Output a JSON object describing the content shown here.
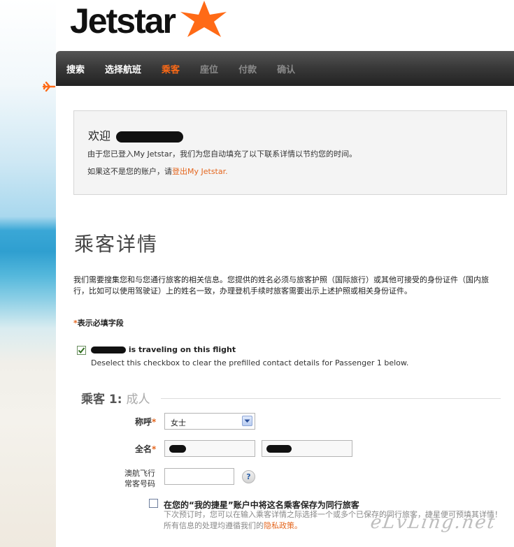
{
  "brand": {
    "logo_text": "Jetstar",
    "accent_color": "#ff6a16"
  },
  "nav": {
    "items": [
      {
        "label": "搜索",
        "state": "done"
      },
      {
        "label": "选择航班",
        "state": "done"
      },
      {
        "label": "乘客",
        "state": "active"
      },
      {
        "label": "座位",
        "state": "disabled"
      },
      {
        "label": "付款",
        "state": "disabled"
      },
      {
        "label": "确认",
        "state": "disabled"
      }
    ]
  },
  "welcome": {
    "title": "欢迎",
    "line1": "由于您已登入My Jetstar，我们为您自动填充了以下联系详情以节约您的时间。",
    "line2_prefix": "如果这不是您的账户，请",
    "line2_link": "登出My Jetstar."
  },
  "page_title": "乘客详情",
  "intro": "我们需要搜集您和与您通行旅客的相关信息。您提供的姓名必须与旅客护照（国际旅行）或其他可接受的身份证件（国内旅行，比如可以使用驾驶证）上的姓名一致，办理登机手续时旅客需要出示上述护照或相关身份证件。",
  "required_note": {
    "star": "*",
    "text": "表示必填字段"
  },
  "traveling": {
    "label": "is traveling on this flight",
    "sublabel": "Deselect this checkbox to clear the prefilled contact details for Passenger 1 below.",
    "checked": true
  },
  "passenger": {
    "heading": "乘客 1:",
    "type": "成人",
    "title_label": "称呼",
    "title_value": "女士",
    "fullname_label": "全名",
    "ff_label_line1": "澳航飞行",
    "ff_label_line2": "常客号码",
    "help_symbol": "?",
    "required_star": "*"
  },
  "save_companion": {
    "label": "在您的“我的捷星”账户中将这名乘客保存为同行旅客",
    "sub_text": "下次预订时，您可以在输入乘客详情之际选择一个或多个已保存的同行旅客，捷星便可预填其详情！ 所有信息的处理均遵循我们的",
    "sub_link": "隐私政策。",
    "checked": false
  },
  "watermark": "eLvLing.net"
}
